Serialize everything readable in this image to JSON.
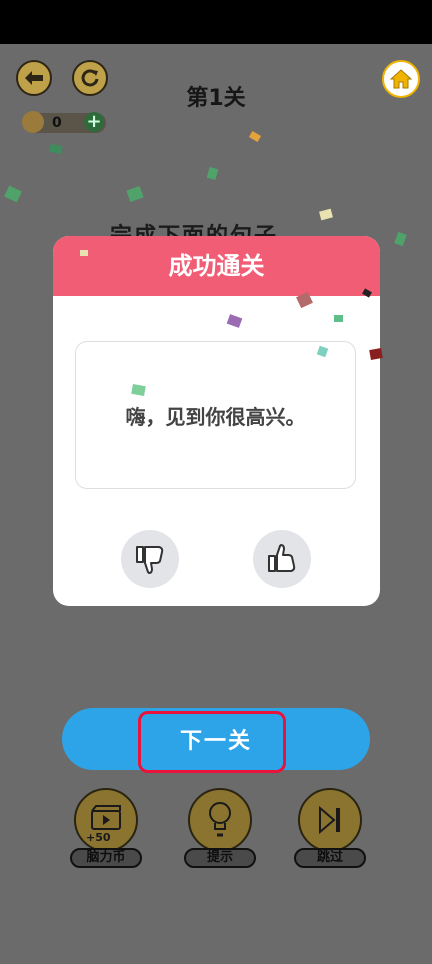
{
  "header": {
    "level_title": "第1关",
    "coins": "0"
  },
  "background": {
    "sentence_partial": "完成下面的句子"
  },
  "modal": {
    "title": "成功通关",
    "sentence": "嗨，见到你很高兴。"
  },
  "actions": {
    "next_label": "下一关"
  },
  "tools": [
    {
      "label": "脑力币",
      "sub": "+50",
      "icon": "video-reward-icon"
    },
    {
      "label": "提示",
      "icon": "lightbulb-icon"
    },
    {
      "label": "跳过",
      "icon": "skip-icon"
    }
  ],
  "colors": {
    "modal_header": "#f25d76",
    "next_button": "#2ea4e8",
    "highlight": "#e8143b"
  }
}
